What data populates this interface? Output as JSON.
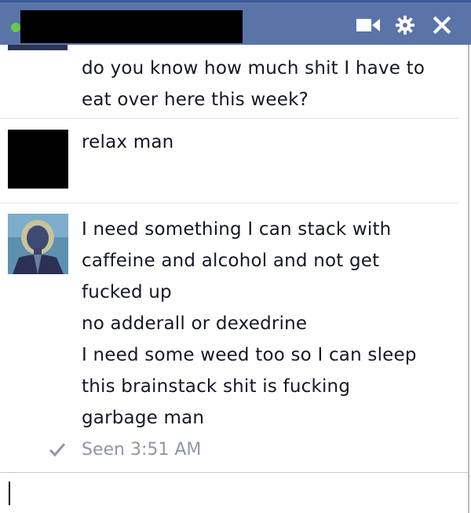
{
  "window": {
    "title": "",
    "status": "online",
    "colors": {
      "titlebar": "#5a74a8",
      "online_dot": "#69c94a",
      "seen_text": "#9197a3"
    },
    "icons": [
      "video-camera-icon",
      "gear-icon",
      "close-icon"
    ]
  },
  "messages": [
    {
      "lines": [
        "do you know how much shit I have to",
        "eat over here this week?"
      ]
    },
    {
      "lines": [
        "relax man"
      ]
    },
    {
      "lines": [
        "I need something I can stack with",
        "caffeine and alcohol and not get",
        "fucked up",
        "no adderall or dexedrine",
        "I need some weed too so I can sleep",
        "this brainstack shit is fucking",
        "garbage man"
      ]
    }
  ],
  "seen": {
    "text": "Seen 3:51 AM"
  },
  "composer": {
    "value": ""
  }
}
